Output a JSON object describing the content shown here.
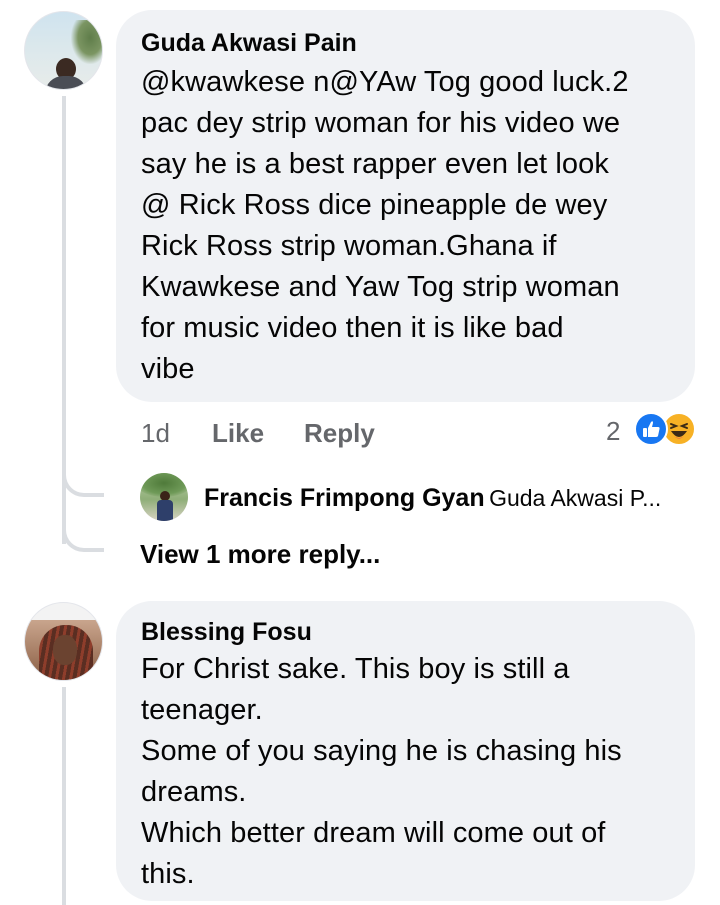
{
  "comments": [
    {
      "author": "Guda Akwasi Pain",
      "text_lines": [
        "@kwawkese n@YAw Tog good luck.2",
        "pac dey strip woman for his video we",
        "say he is a best rapper even let look",
        "@ Rick Ross dice pineapple de wey",
        "Rick Ross strip woman.Ghana if",
        "Kwawkese and Yaw Tog strip woman",
        "for music video then it is like bad",
        "vibe"
      ],
      "time": "1d",
      "like_label": "Like",
      "reply_label": "Reply",
      "reaction_count": "2",
      "reactions": [
        "like-icon",
        "haha-icon"
      ],
      "reply": {
        "author": "Francis Frimpong Gyan",
        "preview": "Guda Akwasi P..."
      },
      "view_more": "View 1 more reply..."
    },
    {
      "author": "Blessing Fosu",
      "text_lines": [
        "For Christ sake. This boy is still a",
        "teenager.",
        "Some of you saying he is chasing his",
        "dreams.",
        "Which better dream will come out of",
        "this."
      ]
    }
  ],
  "colors": {
    "bubble": "#f0f2f5",
    "secondary_text": "#65676b",
    "like_blue": "#1877f2",
    "haha_yellow": "#f7b125",
    "thread_line": "#dadde1"
  }
}
